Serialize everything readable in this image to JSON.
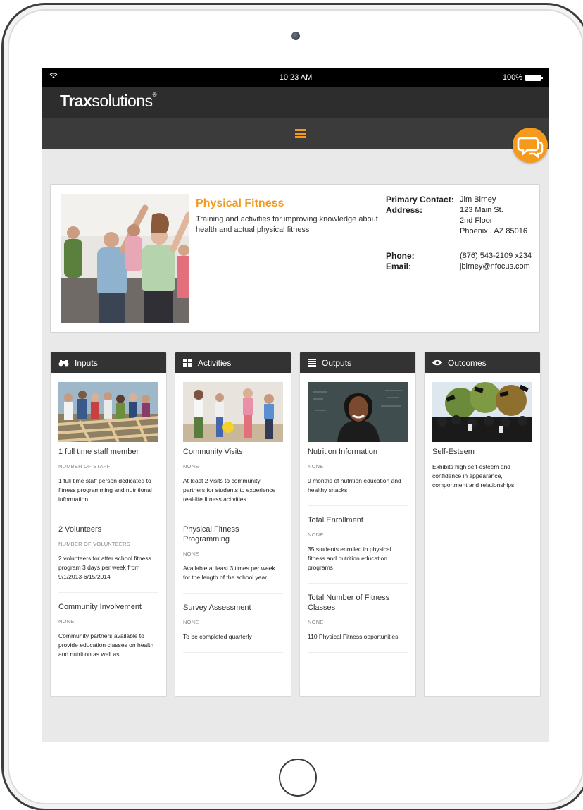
{
  "status_bar": {
    "time": "10:23 AM",
    "battery": "100%"
  },
  "app": {
    "logo_bold": "Trax",
    "logo_light": "solutions",
    "logo_mark": "®"
  },
  "program": {
    "title": "Physical Fitness",
    "description": "Training and activities for improving knowledge about health and actual physical fitness",
    "contact_label": "Primary Contact:",
    "contact_name": "Jim Birney",
    "address_label": "Address:",
    "address_lines": [
      "123 Main St.",
      "2nd Floor",
      "Phoenix , AZ 85016"
    ],
    "phone_label": "Phone:",
    "phone": "(876) 543-2109 x234",
    "email_label": "Email:",
    "email": "jbirney@nfocus.com"
  },
  "columns": {
    "inputs": {
      "title": "Inputs",
      "icon": "binoculars-icon",
      "items": [
        {
          "title": "1 full time staff member",
          "meta": "NUMBER OF STAFF",
          "desc": "1 full time staff person dedicated to fitness programming and nutritional information"
        },
        {
          "title": "2 Volunteers",
          "meta": "NUMBER OF VOLUNTEERS",
          "desc": "2 volunteers for after school fitness program 3 days per week from 9/1/2013-6/15/2014"
        },
        {
          "title": "Community Involvement",
          "meta": "NONE",
          "desc": "Community partners available to provide education classes on health and nutrition as well as"
        }
      ]
    },
    "activities": {
      "title": "Activities",
      "icon": "grid-icon",
      "items": [
        {
          "title": "Community Visits",
          "meta": "NONE",
          "desc": "At least 2 visits to community partners for students to experience real-life fitness activities"
        },
        {
          "title": "Physical Fitness Programming",
          "meta": "NONE",
          "desc": "Available at least 3 times per week for the length of the school year"
        },
        {
          "title": "Survey Assessment",
          "meta": "NONE",
          "desc": "To be completed quarterly"
        }
      ]
    },
    "outputs": {
      "title": "Outputs",
      "icon": "list-icon",
      "items": [
        {
          "title": "Nutrition Information",
          "meta": "NONE",
          "desc": "9 months of nutrition education and healthy snacks"
        },
        {
          "title": "Total Enrollment",
          "meta": "NONE",
          "desc": "35 students enrolled in physical fitness and nutrition education programs"
        },
        {
          "title": "Total Number of Fitness Classes",
          "meta": "NONE",
          "desc": "110 Physical Fitness opportunities"
        }
      ]
    },
    "outcomes": {
      "title": "Outcomes",
      "icon": "eye-icon",
      "items": [
        {
          "title": "Self-Esteem",
          "desc": "Exhibits high self-esteem and confidence in appearance, comportment and relationships."
        }
      ]
    }
  },
  "colors": {
    "accent": "#f39a1e",
    "header_dark": "#2d2d2d",
    "column_header": "#333333"
  }
}
